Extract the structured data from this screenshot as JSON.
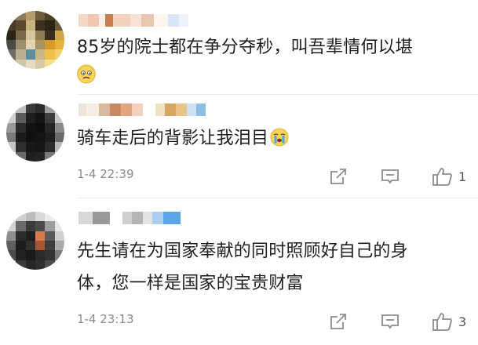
{
  "comments": [
    {
      "text": "85岁的院士都在争分夺秒，叫吾辈情何以堪",
      "emoji": "worried-face-emoji",
      "time": "",
      "likes": ""
    },
    {
      "text": "骑车走后的背影让我泪目",
      "emoji": "crying-face-emoji",
      "time": "1-4 22:39",
      "likes": "1"
    },
    {
      "text_line1": "先生请在为国家奉献的同时照顾好自己的身",
      "text_line2": "体，您一样是国家的宝贵财富",
      "time": "1-4 23:13",
      "likes": "3"
    }
  ],
  "icons": {
    "share": "share-icon",
    "comment": "comment-icon",
    "like": "thumbs-up-icon"
  },
  "colors": {
    "meta_text": "#8a8a8a",
    "icon_stroke": "#8c8c8c"
  }
}
